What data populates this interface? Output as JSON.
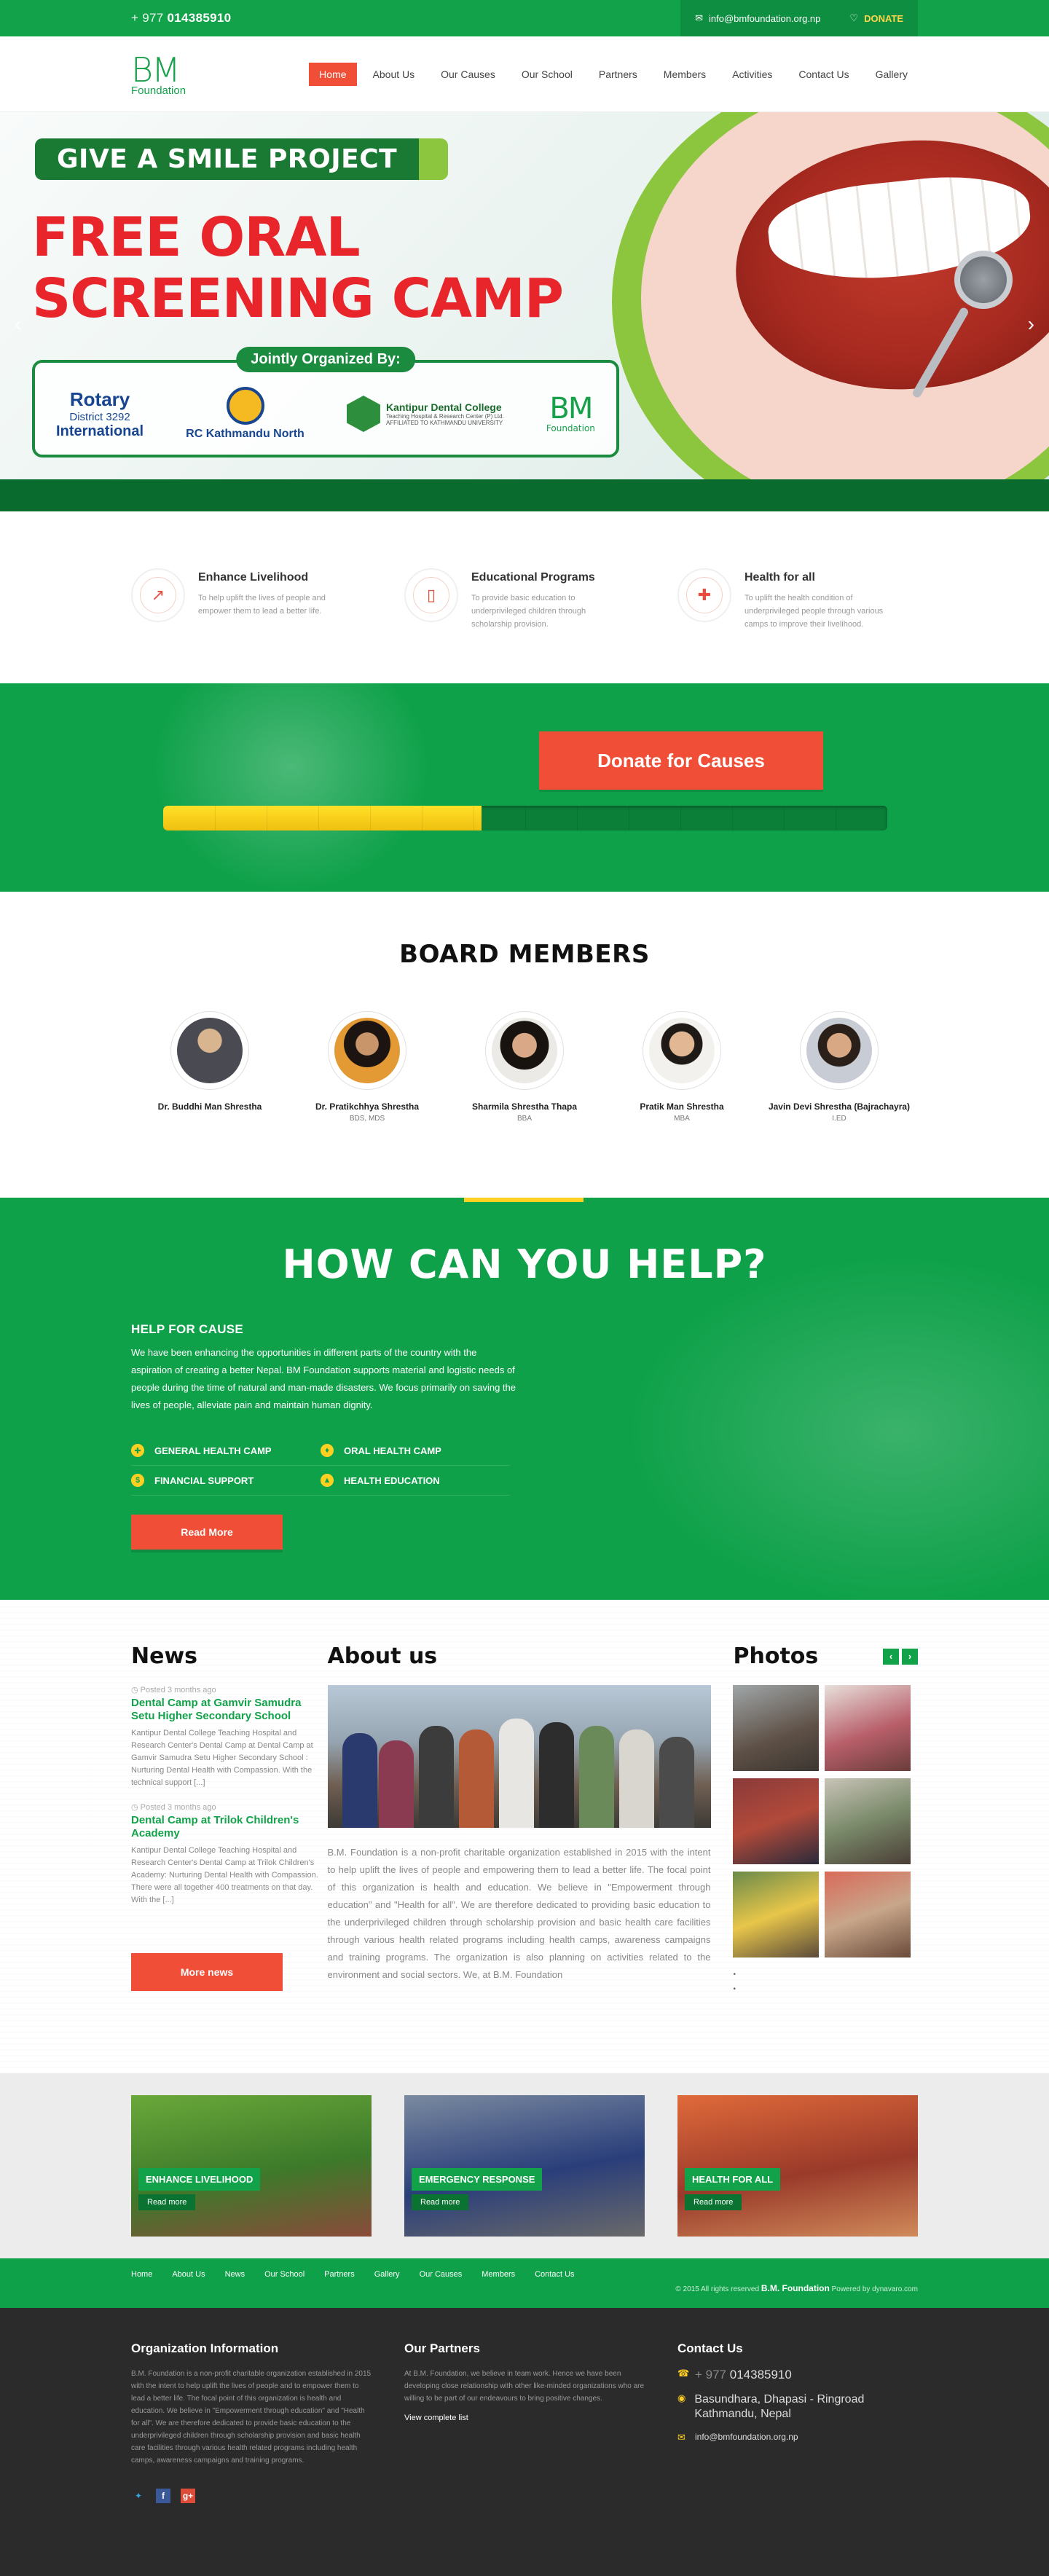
{
  "topbar": {
    "phone_prefix": "+ 977",
    "phone_number": "014385910",
    "email": "info@bmfoundation.org.np",
    "donate_label": "DONATE"
  },
  "logo": {
    "line1": "BM",
    "line2": "Foundation"
  },
  "nav": [
    {
      "label": "Home"
    },
    {
      "label": "About Us"
    },
    {
      "label": "Our Causes"
    },
    {
      "label": "Our School"
    },
    {
      "label": "Partners"
    },
    {
      "label": "Members"
    },
    {
      "label": "Activities"
    },
    {
      "label": "Contact Us"
    },
    {
      "label": "Gallery"
    }
  ],
  "hero": {
    "banner": "GIVE A SMILE PROJECT",
    "title_line1": "FREE ORAL",
    "title_line2": "SCREENING CAMP",
    "organized_label": "Jointly Organized By:",
    "orgs": {
      "rotary_name": "Rotary",
      "rotary_district": "District 3292",
      "rotary_intl": "International",
      "rc_name": "RC Kathmandu North",
      "kdc_name": "Kantipur Dental College",
      "kdc_sub1": "Teaching Hospital & Research Center (P) Ltd.",
      "kdc_sub2": "AFFILIATED TO KATHMANDU UNIVERSITY",
      "bm_line1": "BM",
      "bm_line2": "Foundation"
    }
  },
  "features": [
    {
      "icon": "chart-up-icon",
      "title": "Enhance Livelihood",
      "text": "To help uplift the lives of people and empower them to lead a better life."
    },
    {
      "icon": "book-icon",
      "title": "Educational Programs",
      "text": "To provide basic education to underprivileged children through scholarship provision."
    },
    {
      "icon": "medkit-icon",
      "title": "Health for all",
      "text": "To uplift the health condition of underprivileged people through various camps to improve their livelihood."
    }
  ],
  "donate": {
    "button": "Donate for Causes",
    "progress_fraction": 0.44
  },
  "board": {
    "title": "BOARD MEMBERS",
    "members": [
      {
        "name": "Dr. Buddhi Man Shrestha",
        "qual": ""
      },
      {
        "name": "Dr. Pratikchhya Shrestha",
        "qual": "BDS, MDS"
      },
      {
        "name": "Sharmila Shrestha Thapa",
        "qual": "BBA"
      },
      {
        "name": "Pratik Man Shrestha",
        "qual": "MBA"
      },
      {
        "name": "Javin Devi Shrestha (Bajrachayra)",
        "qual": "I.ED"
      }
    ]
  },
  "help": {
    "title": "HOW CAN YOU HELP?",
    "subtitle": "HELP FOR CAUSE",
    "text": "We have been enhancing the opportunities in different parts of the country with the aspiration of creating a better Nepal. BM Foundation supports material and logistic needs of people during the time of natural and man-made disasters. We focus primarily on saving the lives of people, alleviate pain and maintain human dignity.",
    "causes": [
      {
        "icon": "medkit-icon",
        "label": "GENERAL HEALTH CAMP"
      },
      {
        "icon": "tooth-icon",
        "label": "ORAL HEALTH CAMP"
      },
      {
        "icon": "dollar-icon",
        "label": "FINANCIAL SUPPORT"
      },
      {
        "icon": "graduation-cap-icon",
        "label": "HEALTH EDUCATION"
      }
    ],
    "button": "Read More"
  },
  "news": {
    "title": "News",
    "items": [
      {
        "date": "Posted 3 months ago",
        "title": "Dental Camp at Gamvir Samudra Setu Higher Secondary School",
        "text": "Kantipur Dental College Teaching Hospital and Research Center's Dental Camp at Dental Camp at Gamvir Samudra Setu Higher Secondary School : Nurturing Dental Health with Compassion. With the technical support [...]"
      },
      {
        "date": "Posted 3 months ago",
        "title": "Dental Camp at Trilok Children's Academy",
        "text": "Kantipur Dental College Teaching Hospital and Research Center's Dental Camp at Trilok Children's Academy: Nurturing Dental Health with Compassion. There were all together 400 treatments on that day. With the [...]"
      }
    ],
    "button": "More news"
  },
  "about": {
    "title": "About us",
    "text": "B.M. Foundation is a non-profit charitable organization established in 2015 with the intent to help uplift the lives of people and empowering them to lead a better life. The focal point of this organization is health and education. We believe in \"Empowerment through education\" and \"Health for all\". We are therefore dedicated to providing basic education to the underprivileged children through scholarship provision and basic health care facilities through various health related programs including health camps, awareness campaigns and training programs. The organization is also planning on activities related to the environment and social sectors. We, at B.M. Foundation"
  },
  "photos": {
    "title": "Photos"
  },
  "programs": [
    {
      "label": "ENHANCE LIVELIHOOD",
      "more": "Read more"
    },
    {
      "label": "EMERGENCY RESPONSE",
      "more": "Read more"
    },
    {
      "label": "HEALTH FOR ALL",
      "more": "Read more"
    }
  ],
  "footer_nav": {
    "links": [
      "Home",
      "About Us",
      "News",
      "Our School",
      "Partners",
      "Gallery",
      "Our Causes",
      "Members",
      "Contact Us"
    ],
    "copyright": "© 2015 All rights reserved",
    "brand": "B.M. Foundation",
    "powered": "Powered by dynavaro.com"
  },
  "footer": {
    "org_title": "Organization Information",
    "org_text": "B.M. Foundation is a non-profit charitable organization established in 2015 with the intent to help uplift the lives of people and to empower them to lead a better life. The focal point of this organization is health and education. We believe in \"Empowerment through education\" and \"Health for all\". We are therefore dedicated to provide basic education to the underprivileged children through scholarship provision and basic health care facilities through various health related programs including health camps, awareness campaigns and training programs.",
    "partners_title": "Our Partners",
    "partners_text": "At B.M. Foundation, we believe in team work. Hence we have been developing close relationship with other like-minded organizations who are willing to be part of our endeavours to bring positive changes.",
    "partners_link": "View complete list",
    "contact_title": "Contact Us",
    "contact_phone_prefix": "+ 977",
    "contact_phone": "014385910",
    "contact_address": "Basundhara, Dhapasi - Ringroad Kathmandu, Nepal",
    "contact_email": "info@bmfoundation.org.np"
  },
  "colors": {
    "green": "#12a24a",
    "red": "#f04e37",
    "yellow": "#ffd022",
    "dark": "#2b2b2b"
  }
}
